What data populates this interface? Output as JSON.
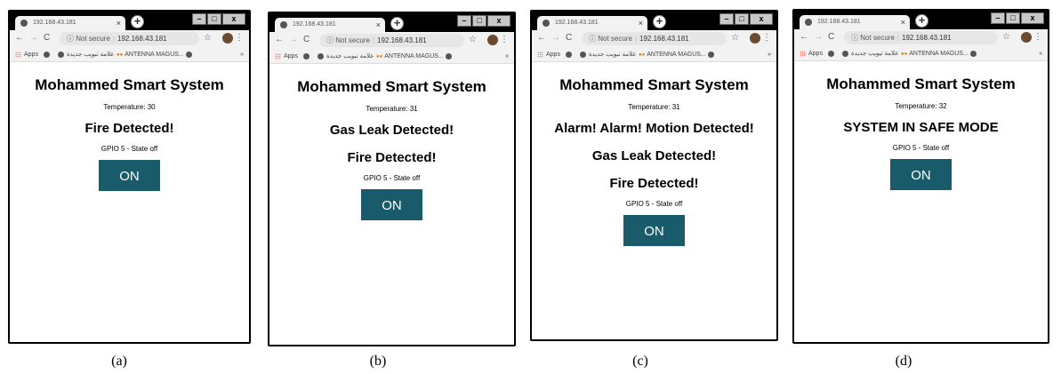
{
  "browser": {
    "tab_title": "192.168.43.181",
    "tab_close": "×",
    "new_tab": "+",
    "minimize": "–",
    "maximize": "□",
    "close": "x",
    "back": "←",
    "forward": "→",
    "reload": "C",
    "security_icon": "ⓘ",
    "security_label": "Not secure",
    "url": "192.168.43.181",
    "star": "☆",
    "menu": "⋮",
    "bookmarks": {
      "apps": "Apps",
      "arabic": "علامة تبويب جديدة",
      "antenna": "ANTENNA MAGUS...",
      "more": "»"
    }
  },
  "app": {
    "title": "Mohammed Smart System",
    "gpio_label": "GPIO 5 - State off",
    "button_label": "ON"
  },
  "panels": [
    {
      "temperature": "Temperature: 30",
      "messages": [
        "Fire Detected!"
      ],
      "caption": "(a)"
    },
    {
      "temperature": "Temperature: 31",
      "messages": [
        "Gas Leak Detected!",
        "Fire Detected!"
      ],
      "caption": "(b)"
    },
    {
      "temperature": "Temperature: 31",
      "messages": [
        "Alarm! Alarm! Motion Detected!",
        "Gas Leak Detected!",
        "Fire Detected!"
      ],
      "caption": "(c)"
    },
    {
      "temperature": "Temperature: 32",
      "messages": [
        "SYSTEM IN SAFE MODE"
      ],
      "caption": "(d)"
    }
  ],
  "colors": {
    "button_bg": "#195b6a",
    "frame": "#000000"
  }
}
